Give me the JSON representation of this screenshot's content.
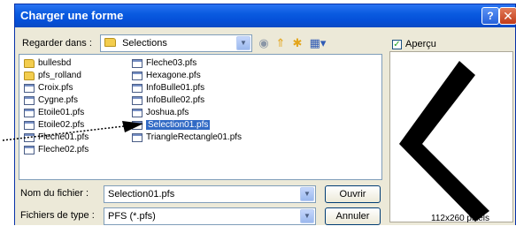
{
  "window": {
    "title": "Charger une forme"
  },
  "look_in": {
    "label": "Regarder dans :",
    "underline_char": "R",
    "value": "Selections"
  },
  "files": [
    {
      "name": "bullesbd",
      "type": "folder"
    },
    {
      "name": "pfs_rolland",
      "type": "folder"
    },
    {
      "name": "Croix.pfs",
      "type": "file"
    },
    {
      "name": "Cygne.pfs",
      "type": "file"
    },
    {
      "name": "Etoile01.pfs",
      "type": "file"
    },
    {
      "name": "Etoile02.pfs",
      "type": "file"
    },
    {
      "name": "Fleche01.pfs",
      "type": "file"
    },
    {
      "name": "Fleche02.pfs",
      "type": "file"
    },
    {
      "name": "Fleche03.pfs",
      "type": "file"
    },
    {
      "name": "Hexagone.pfs",
      "type": "file"
    },
    {
      "name": "InfoBulle01.pfs",
      "type": "file"
    },
    {
      "name": "InfoBulle02.pfs",
      "type": "file"
    },
    {
      "name": "Joshua.pfs",
      "type": "file"
    },
    {
      "name": "Selection01.pfs",
      "type": "file",
      "selected": true
    },
    {
      "name": "TriangleRectangle01.pfs",
      "type": "file"
    }
  ],
  "filename": {
    "label": "Nom du fichier :",
    "value": "Selection01.pfs"
  },
  "filetype": {
    "label": "Fichiers de type :",
    "value": "PFS (*.pfs)"
  },
  "buttons": {
    "open": "Ouvrir",
    "cancel": "Annuler"
  },
  "preview": {
    "label": "Aperçu",
    "checked": true,
    "size": "112x260 pixels"
  },
  "icons": {
    "help": "help-icon",
    "close": "close-icon",
    "back": "back-icon",
    "up": "up-folder-icon",
    "new_folder": "new-folder-icon",
    "view": "view-menu-icon"
  }
}
